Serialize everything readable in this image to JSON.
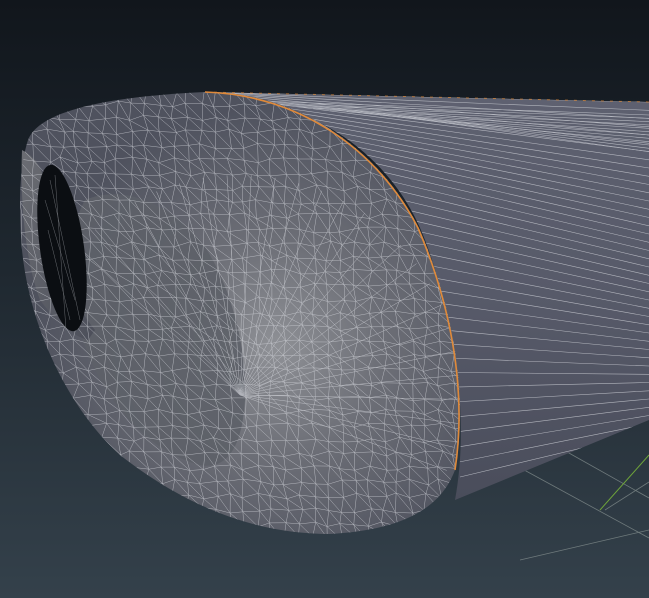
{
  "viewport": {
    "view_type": "3d-perspective",
    "display_mode": "wireframe-on-shaded",
    "object": {
      "shape": "muffler-tip",
      "selected_edge_loop": true
    },
    "grid_visible": true,
    "colors": {
      "background_top": "#11161c",
      "background_bottom": "#34414b",
      "mesh_shaded": "#5b5e6a",
      "mesh_highlight": "#8a8c90",
      "wireframe": "#d6d8de",
      "selection_edge": "#e08a3a",
      "grid_line": "#7f8a8a",
      "grid_axis_green": "#6fa53a",
      "hole_interior": "#0b0e12"
    }
  }
}
